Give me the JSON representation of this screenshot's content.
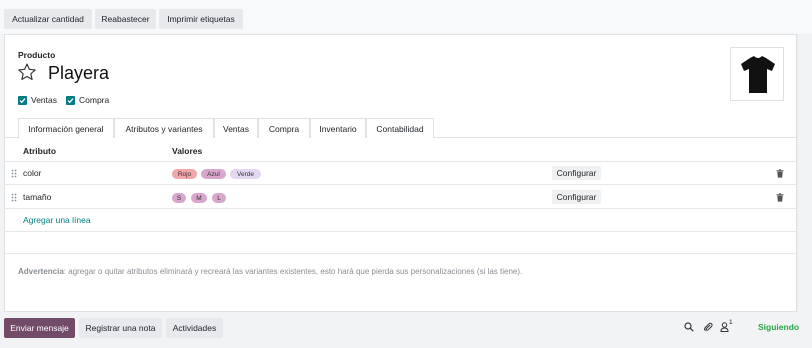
{
  "toolbar": {
    "update_qty": "Actualizar cantidad",
    "replenish": "Reabastecer",
    "print_labels": "Imprimir etiquetas"
  },
  "product": {
    "field_label": "Producto",
    "name": "Playera",
    "sale_ok_label": "Ventas",
    "purchase_ok_label": "Compra",
    "sale_ok": true,
    "purchase_ok": true,
    "favorite": false
  },
  "tabs": [
    {
      "label": "Información general",
      "active": false
    },
    {
      "label": "Atributos y variantes",
      "active": true
    },
    {
      "label": "Ventas",
      "active": false
    },
    {
      "label": "Compra",
      "active": false
    },
    {
      "label": "Inventario",
      "active": false
    },
    {
      "label": "Contabilidad",
      "active": false
    }
  ],
  "attributes_table": {
    "col_attribute": "Atributo",
    "col_values": "Valores",
    "rows": [
      {
        "attribute": "color",
        "values": [
          {
            "label": "Rojo",
            "color": "#f4a5a9"
          },
          {
            "label": "Azul",
            "color": "#d9a7cd"
          },
          {
            "label": "Verde",
            "color": "#e4d7f2"
          }
        ],
        "configure": "Configurar"
      },
      {
        "attribute": "tamaño",
        "values": [
          {
            "label": "S",
            "color": "#d9a7cd"
          },
          {
            "label": "M",
            "color": "#d9a7cd"
          },
          {
            "label": "L",
            "color": "#d9a7cd"
          }
        ],
        "configure": "Configurar"
      }
    ],
    "add_line": "Agregar una línea"
  },
  "warning": {
    "title": "Advertencia",
    "text": ": agregar o quitar atributos eliminará y recreará las variantes existentes, esto hará que pierda sus personalizaciones (si las tiene)."
  },
  "chatter": {
    "send_message": "Enviar mensaje",
    "log_note": "Registrar una nota",
    "activities": "Actividades",
    "followers_count": "1",
    "following": "Siguiendo"
  },
  "colors": {
    "primary": "#714b67",
    "accent": "#017e84",
    "following": "#28a745"
  }
}
